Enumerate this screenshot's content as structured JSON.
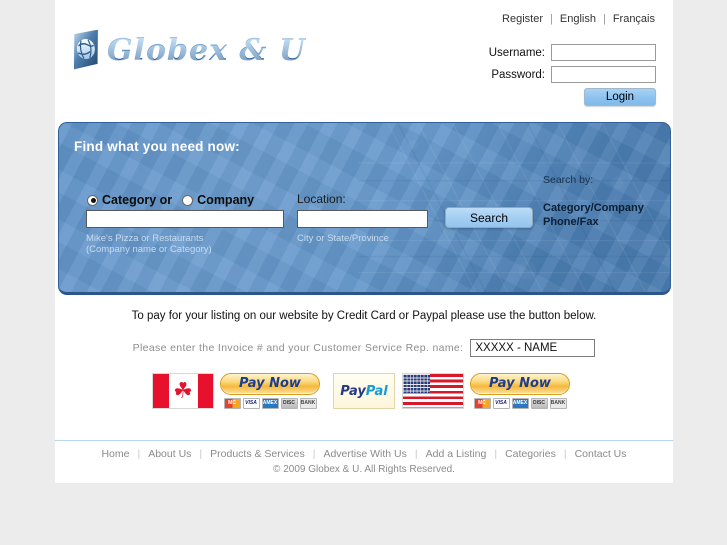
{
  "brand": {
    "name": "Globex & U",
    "logo_icon": "globe-icon"
  },
  "header": {
    "top_links": [
      {
        "label": "Register",
        "name": "register"
      },
      {
        "label": "English",
        "name": "english"
      },
      {
        "label": "Français",
        "name": "francais"
      }
    ],
    "separator": "|",
    "login": {
      "username_label": "Username:",
      "username_value": "",
      "password_label": "Password:",
      "password_value": "",
      "login_button": "Login"
    }
  },
  "search_panel": {
    "title": "Find what you need now:",
    "radio_category_label": "Category or",
    "radio_company_label": "Company",
    "selected_radio": "category",
    "query_value": "",
    "query_hint_line1": "Mike's Pizza or Restaurants",
    "query_hint_line2": "(Company name or Category)",
    "location_label": "Location:",
    "location_value": "",
    "location_hint": "City or State/Province",
    "search_button": "Search",
    "search_by_label": "Search by:",
    "search_by_line1": "Category/Company",
    "search_by_line2": "Phone/Fax"
  },
  "payment": {
    "intro": "To pay for your listing on our website by Credit Card or Paypal please use the button below.",
    "invoice_label": "Please enter the Invoice # and your Customer Service Rep. name:",
    "invoice_value": "XXXXX - NAME",
    "canada": {
      "flag_name": "canada-flag-icon",
      "flag_glyph": "☘",
      "pay_button": "Pay Now"
    },
    "usa": {
      "flag_name": "usa-flag-icon",
      "pay_button": "Pay Now"
    },
    "paypal_logo_text_a": "Pay",
    "paypal_logo_text_b": "Pal",
    "cards": [
      {
        "name": "mastercard",
        "label": "MC"
      },
      {
        "name": "visa",
        "label": "VISA"
      },
      {
        "name": "amex",
        "label": "AMEX"
      },
      {
        "name": "discover",
        "label": "DISC"
      },
      {
        "name": "bank",
        "label": "BANK"
      }
    ]
  },
  "footer": {
    "links": [
      {
        "label": "Home",
        "name": "home"
      },
      {
        "label": "About Us",
        "name": "about-us"
      },
      {
        "label": "Products & Services",
        "name": "products-services"
      },
      {
        "label": "Advertise With Us",
        "name": "advertise-with-us"
      },
      {
        "label": "Add a Listing",
        "name": "add-a-listing"
      },
      {
        "label": "Categories",
        "name": "categories"
      },
      {
        "label": "Contact Us",
        "name": "contact-us"
      }
    ],
    "separator": "|",
    "copyright": "© 2009 Globex & U. All Rights Reserved."
  },
  "colors": {
    "panel_blue": "#5f93c9",
    "panel_border": "#33609c",
    "button_blue": "#a5cff2",
    "paynow_gold": "#f6b73c",
    "footer_text": "#8b8b8b",
    "rule_blue": "#bcd8ee"
  }
}
